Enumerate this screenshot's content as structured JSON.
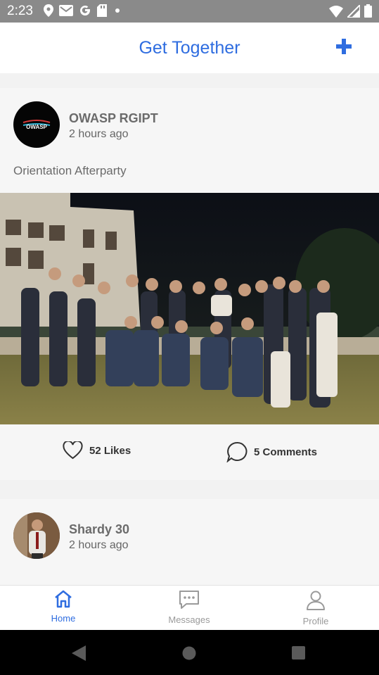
{
  "status_bar": {
    "time": "2:23",
    "icons": [
      "location-icon",
      "gmail-icon",
      "google-icon",
      "sd-card-icon",
      "dot-icon",
      "wifi-icon",
      "signal-icon",
      "battery-icon"
    ]
  },
  "app_bar": {
    "title": "Get Together",
    "add_icon": "plus-icon",
    "accent_color": "#2f6de0"
  },
  "posts": [
    {
      "author": "OWASP RGIPT",
      "time": "2 hours ago",
      "caption": "Orientation Afterparty",
      "avatar_text": "OWASP",
      "likes_label": "52 Likes",
      "comments_label": "5 Comments"
    },
    {
      "author": "Shardy 30",
      "time": "2 hours ago"
    }
  ],
  "tabs": [
    {
      "label": "Home",
      "icon": "home-icon",
      "active": true
    },
    {
      "label": "Messages",
      "icon": "chat-icon",
      "active": false
    },
    {
      "label": "Profile",
      "icon": "person-icon",
      "active": false
    }
  ],
  "nav_bar": [
    "back-icon",
    "home-circle-icon",
    "recents-icon"
  ]
}
